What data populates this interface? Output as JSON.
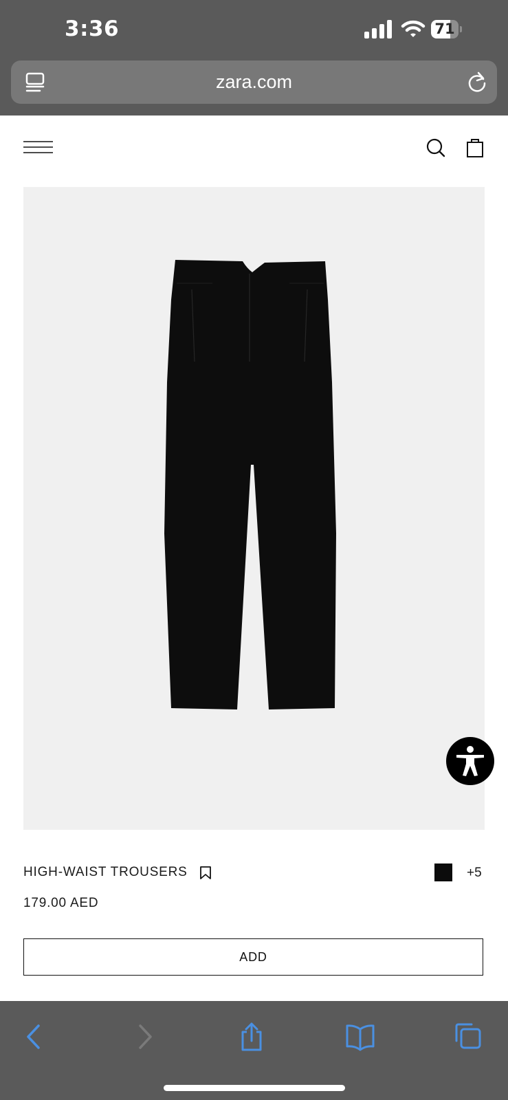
{
  "status_bar": {
    "time": "3:36",
    "battery_level": "71",
    "battery_fraction": 0.71
  },
  "browser": {
    "url": "zara.com"
  },
  "product": {
    "name": "HIGH-WAIST TROUSERS",
    "price": "179.00 AED",
    "swatch_color": "#0c0c0c",
    "more_colors": "+5",
    "add_label": "ADD"
  },
  "colors": {
    "chrome": "#5a5a5a",
    "toolbar_icon_active": "#4a90e2",
    "toolbar_icon_disabled": "#7a7a7a",
    "image_background": "#f0f0f0",
    "garment": "#0d0d0d"
  },
  "icons": {
    "reader": "reader-mode-icon",
    "reload": "reload-icon",
    "menu": "hamburger-menu-icon",
    "search": "search-icon",
    "bag": "shopping-bag-icon",
    "bookmark": "bookmark-icon",
    "accessibility": "accessibility-icon",
    "back": "back-arrow-icon",
    "forward": "forward-arrow-icon",
    "share": "share-icon",
    "bookmarks": "bookmarks-book-icon",
    "tabs": "tabs-icon"
  }
}
